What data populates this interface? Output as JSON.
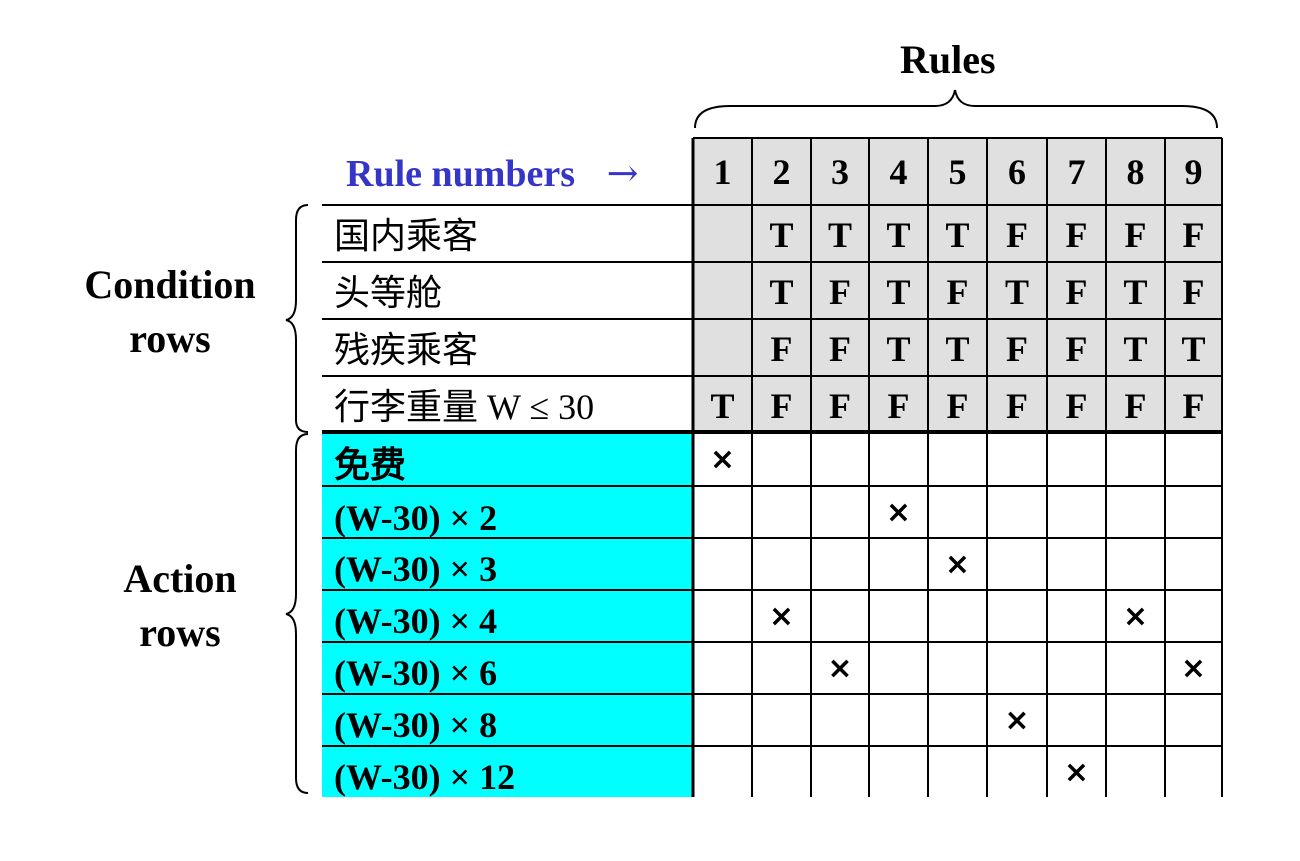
{
  "title": "Rules",
  "rule_numbers_label": "Rule numbers",
  "rule_numbers_arrow": "→",
  "rule_numbers": [
    "1",
    "2",
    "3",
    "4",
    "5",
    "6",
    "7",
    "8",
    "9"
  ],
  "condition_side_label": [
    "Condition",
    "rows"
  ],
  "action_side_label": [
    "Action",
    "rows"
  ],
  "conditions": [
    {
      "label": "国内乘客",
      "values": [
        "",
        "T",
        "T",
        "T",
        "T",
        "F",
        "F",
        "F",
        "F"
      ]
    },
    {
      "label": "头等舱",
      "values": [
        "",
        "T",
        "F",
        "T",
        "F",
        "T",
        "F",
        "T",
        "F"
      ]
    },
    {
      "label": "残疾乘客",
      "values": [
        "",
        "F",
        "F",
        "T",
        "T",
        "F",
        "F",
        "T",
        "T"
      ]
    },
    {
      "label": "行李重量 W ≤ 30",
      "values": [
        "T",
        "F",
        "F",
        "F",
        "F",
        "F",
        "F",
        "F",
        "F"
      ]
    }
  ],
  "actions": [
    {
      "label": "免费",
      "rule": 1
    },
    {
      "label": "(W-30) × 2",
      "rule": 4
    },
    {
      "label": "(W-30) × 3",
      "rule": 5
    },
    {
      "label": "(W-30) × 4",
      "rule": [
        2,
        8
      ]
    },
    {
      "label": "(W-30) × 6",
      "rule": [
        3,
        9
      ]
    },
    {
      "label": "(W-30) × 8",
      "rule": 6
    },
    {
      "label": "(W-30) × 12",
      "rule": 7
    }
  ],
  "mark_symbol": "×",
  "colors": {
    "header_gray": "#e0e0e0",
    "action_cyan": "#00ffff",
    "rule_label": "#3535c8"
  }
}
